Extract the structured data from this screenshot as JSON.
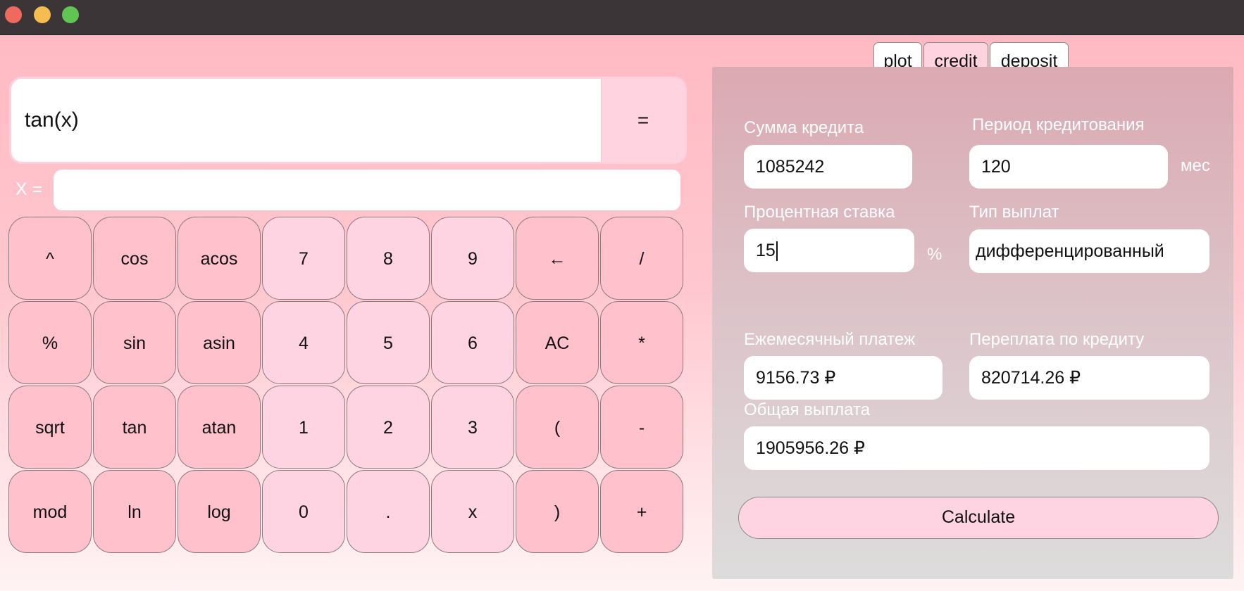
{
  "calculator": {
    "expression": "tan(x)",
    "equals_label": "=",
    "x_label": "X =",
    "x_value": "",
    "keys": [
      {
        "label": "^",
        "style": "pink",
        "name": "key-power"
      },
      {
        "label": "cos",
        "style": "pink",
        "name": "key-cos"
      },
      {
        "label": "acos",
        "style": "pink",
        "name": "key-acos"
      },
      {
        "label": "7",
        "style": "light",
        "name": "key-7"
      },
      {
        "label": "8",
        "style": "light",
        "name": "key-8"
      },
      {
        "label": "9",
        "style": "light",
        "name": "key-9"
      },
      {
        "label": "←",
        "style": "pink",
        "name": "key-backspace"
      },
      {
        "label": "/",
        "style": "pink",
        "name": "key-divide"
      },
      {
        "label": "%",
        "style": "pink",
        "name": "key-percent"
      },
      {
        "label": "sin",
        "style": "pink",
        "name": "key-sin"
      },
      {
        "label": "asin",
        "style": "pink",
        "name": "key-asin"
      },
      {
        "label": "4",
        "style": "light",
        "name": "key-4"
      },
      {
        "label": "5",
        "style": "light",
        "name": "key-5"
      },
      {
        "label": "6",
        "style": "light",
        "name": "key-6"
      },
      {
        "label": "AC",
        "style": "pink",
        "name": "key-clear"
      },
      {
        "label": "*",
        "style": "pink",
        "name": "key-multiply"
      },
      {
        "label": "sqrt",
        "style": "pink",
        "name": "key-sqrt"
      },
      {
        "label": "tan",
        "style": "pink",
        "name": "key-tan"
      },
      {
        "label": "atan",
        "style": "pink",
        "name": "key-atan"
      },
      {
        "label": "1",
        "style": "light",
        "name": "key-1"
      },
      {
        "label": "2",
        "style": "light",
        "name": "key-2"
      },
      {
        "label": "3",
        "style": "light",
        "name": "key-3"
      },
      {
        "label": "(",
        "style": "pink",
        "name": "key-open-paren"
      },
      {
        "label": "-",
        "style": "pink",
        "name": "key-minus"
      },
      {
        "label": "mod",
        "style": "pink",
        "name": "key-mod"
      },
      {
        "label": "ln",
        "style": "pink",
        "name": "key-ln"
      },
      {
        "label": "log",
        "style": "pink",
        "name": "key-log"
      },
      {
        "label": "0",
        "style": "light",
        "name": "key-0"
      },
      {
        "label": ".",
        "style": "light",
        "name": "key-dot"
      },
      {
        "label": "x",
        "style": "light",
        "name": "key-x"
      },
      {
        "label": ")",
        "style": "pink",
        "name": "key-close-paren"
      },
      {
        "label": "+",
        "style": "pink",
        "name": "key-plus"
      }
    ]
  },
  "tabs": [
    {
      "label": "plot",
      "active": false
    },
    {
      "label": "credit",
      "active": true
    },
    {
      "label": "deposit",
      "active": false
    }
  ],
  "credit": {
    "amount_label": "Сумма кредита",
    "amount_value": "1085242",
    "period_label": "Период кредитования",
    "period_value": "120",
    "period_unit": "мес",
    "rate_label": "Процентная ставка",
    "rate_value": "15",
    "rate_unit": "%",
    "type_label": "Тип выплат",
    "type_value": "дифференцированный",
    "monthly_label": "Ежемесячный платеж",
    "monthly_value": "9156.73 ₽",
    "overpay_label": "Переплата по кредиту",
    "overpay_value": "820714.26 ₽",
    "total_label": "Общая выплата",
    "total_value": "1905956.26 ₽",
    "calculate_label": "Calculate"
  },
  "colors": {
    "key_pink": "#ffc2cc",
    "key_light": "#ffd4e2",
    "titlebar": "#3b3538"
  }
}
